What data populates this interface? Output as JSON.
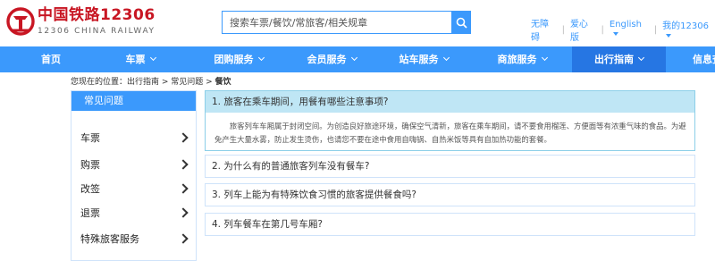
{
  "header": {
    "brand_cn": "中国铁路12306",
    "brand_en": "12306 CHINA RAILWAY",
    "search_placeholder": "搜索车票/餐饮/常旅客/相关规章",
    "links": {
      "accessibility": "无障碍",
      "care": "爱心版",
      "language": "English",
      "my12306": "我的12306"
    }
  },
  "nav": {
    "items": [
      {
        "label": "首页",
        "has_caret": false,
        "active": false
      },
      {
        "label": "车票",
        "has_caret": true,
        "active": false
      },
      {
        "label": "团购服务",
        "has_caret": true,
        "active": false
      },
      {
        "label": "会员服务",
        "has_caret": true,
        "active": false
      },
      {
        "label": "站车服务",
        "has_caret": true,
        "active": false
      },
      {
        "label": "商旅服务",
        "has_caret": true,
        "active": false
      },
      {
        "label": "出行指南",
        "has_caret": true,
        "active": true
      },
      {
        "label": "信息查",
        "has_caret": false,
        "active": false
      }
    ]
  },
  "breadcrumb": {
    "prefix": "您现在的位置：出行指南 > 常见问题 > ",
    "current": "餐饮"
  },
  "sidebar": {
    "title": "常见问题",
    "items": [
      {
        "label": "车票"
      },
      {
        "label": "购票"
      },
      {
        "label": "改签"
      },
      {
        "label": "退票"
      },
      {
        "label": "特殊旅客服务"
      }
    ]
  },
  "questions": [
    {
      "title": "1. 旅客在乘车期间，用餐有哪些注意事项?",
      "open": true,
      "answer": "旅客列车车厢属于封闭空间。为创造良好旅途环境，确保空气清新，旅客在乘车期间，请不要食用榴莲、方便面等有浓重气味的食品。为避免产生大量水雾，防止发生烫伤，也请您不要在途中食用自嗨锅、自热米饭等具有自加热功能的套餐。"
    },
    {
      "title": "2. 为什么有的普通旅客列车没有餐车?",
      "open": false
    },
    {
      "title": "3. 列车上能为有特殊饮食习惯的旅客提供餐食吗?",
      "open": false
    },
    {
      "title": "4. 列车餐车在第几号车厢?",
      "open": false
    }
  ],
  "colors": {
    "brand_red": "#c81623",
    "nav_blue": "#3b99fc",
    "nav_active": "#2676e3",
    "question_highlight": "#bfe6f5"
  }
}
